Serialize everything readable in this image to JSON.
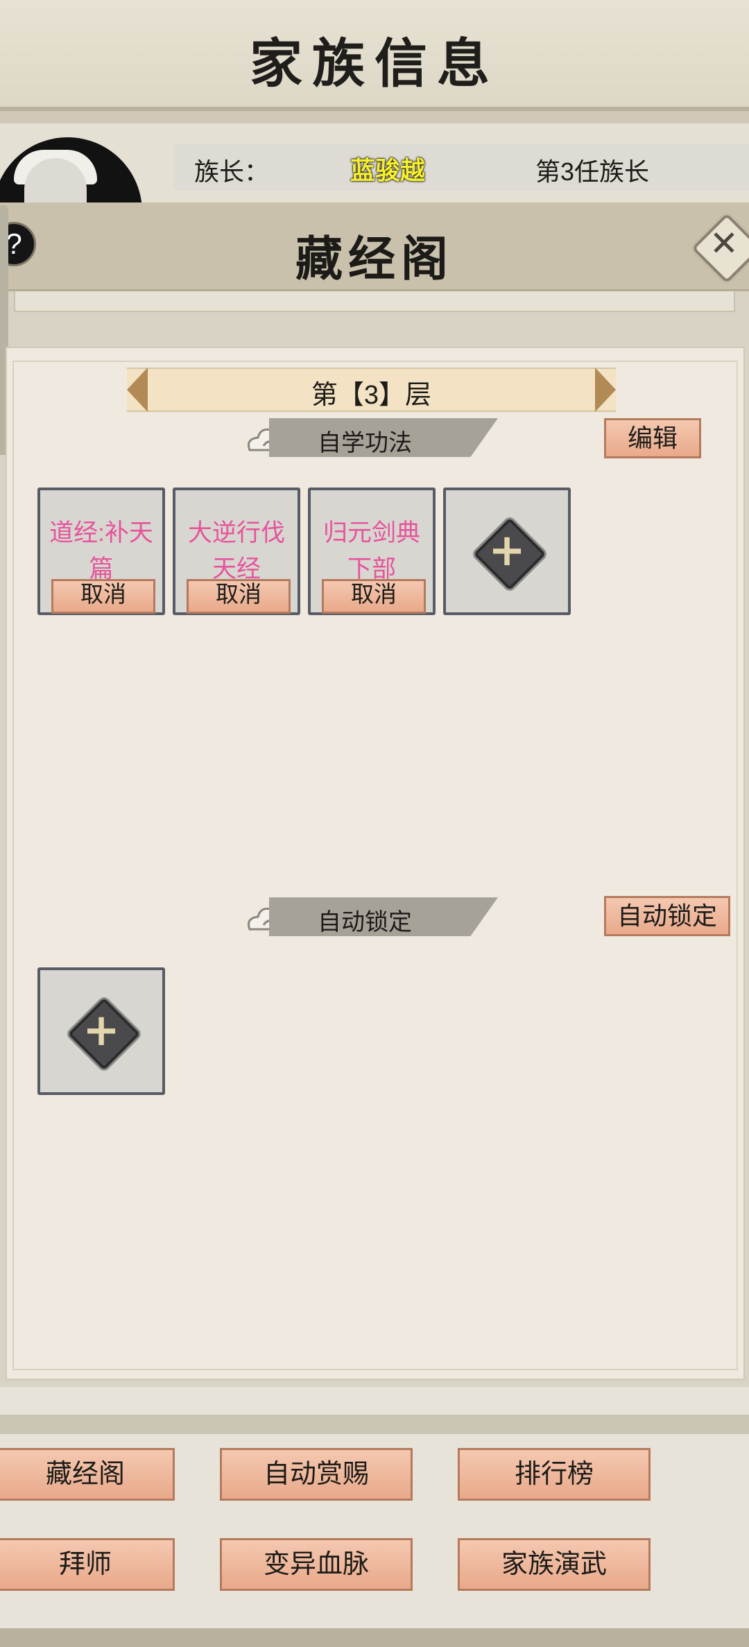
{
  "header": {
    "title": "家族信息"
  },
  "leader": {
    "label": "族长：",
    "name": "蓝骏越",
    "rank": "第3任族长"
  },
  "modal": {
    "title": "藏经阁",
    "help_label": "?",
    "close_label": "✕"
  },
  "floor": {
    "label": "第【3】层"
  },
  "sections": {
    "self_study": {
      "title": "自学功法",
      "action_label": "编辑"
    },
    "auto_lock": {
      "title": "自动锁定",
      "action_label": "自动锁定"
    }
  },
  "technique_slots": [
    {
      "name": "道经:补天篇",
      "cancel_label": "取消"
    },
    {
      "name": "大逆行伐天经",
      "cancel_label": "取消"
    },
    {
      "name": "归元剑典下部",
      "cancel_label": "取消"
    }
  ],
  "add_slot_glyph": "+",
  "bottom_nav": [
    {
      "label": "藏经阁"
    },
    {
      "label": "自动赏赐"
    },
    {
      "label": "排行榜"
    },
    {
      "label": "拜师"
    },
    {
      "label": "变异血脉"
    },
    {
      "label": "家族演武"
    }
  ],
  "colors": {
    "skill_name": "#e6549b",
    "leader_name": "#f5ef2f",
    "button_peach": "#f0bba0"
  }
}
